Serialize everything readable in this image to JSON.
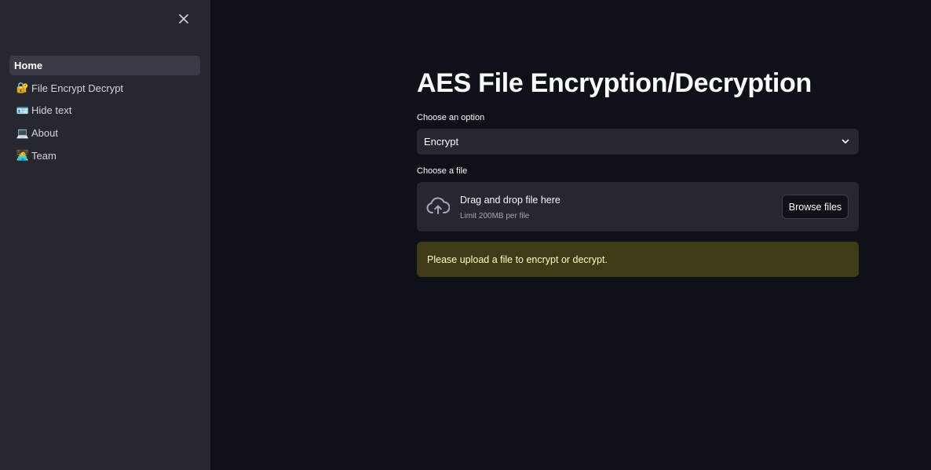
{
  "sidebar": {
    "items": [
      {
        "emoji": "",
        "label": "Home",
        "active": true
      },
      {
        "emoji": "🔐",
        "label": "File Encrypt Decrypt",
        "active": false
      },
      {
        "emoji": "🪪",
        "label": "Hide text",
        "active": false
      },
      {
        "emoji": "💻",
        "label": "About",
        "active": false
      },
      {
        "emoji": "🧑‍💻",
        "label": "Team",
        "active": false
      }
    ]
  },
  "main": {
    "title": "AES File Encryption/Decryption",
    "option_label": "Choose an option",
    "option_value": "Encrypt",
    "file_label": "Choose a file",
    "dropzone": {
      "title": "Drag and drop file here",
      "subtitle": "Limit 200MB per file",
      "browse_label": "Browse files"
    },
    "alert": "Please upload a file to encrypt or decrypt."
  },
  "colors": {
    "background": "#0e1117",
    "sidebar": "#262730",
    "alert_bg": "#3e3b16",
    "alert_text": "#ffffc2"
  }
}
